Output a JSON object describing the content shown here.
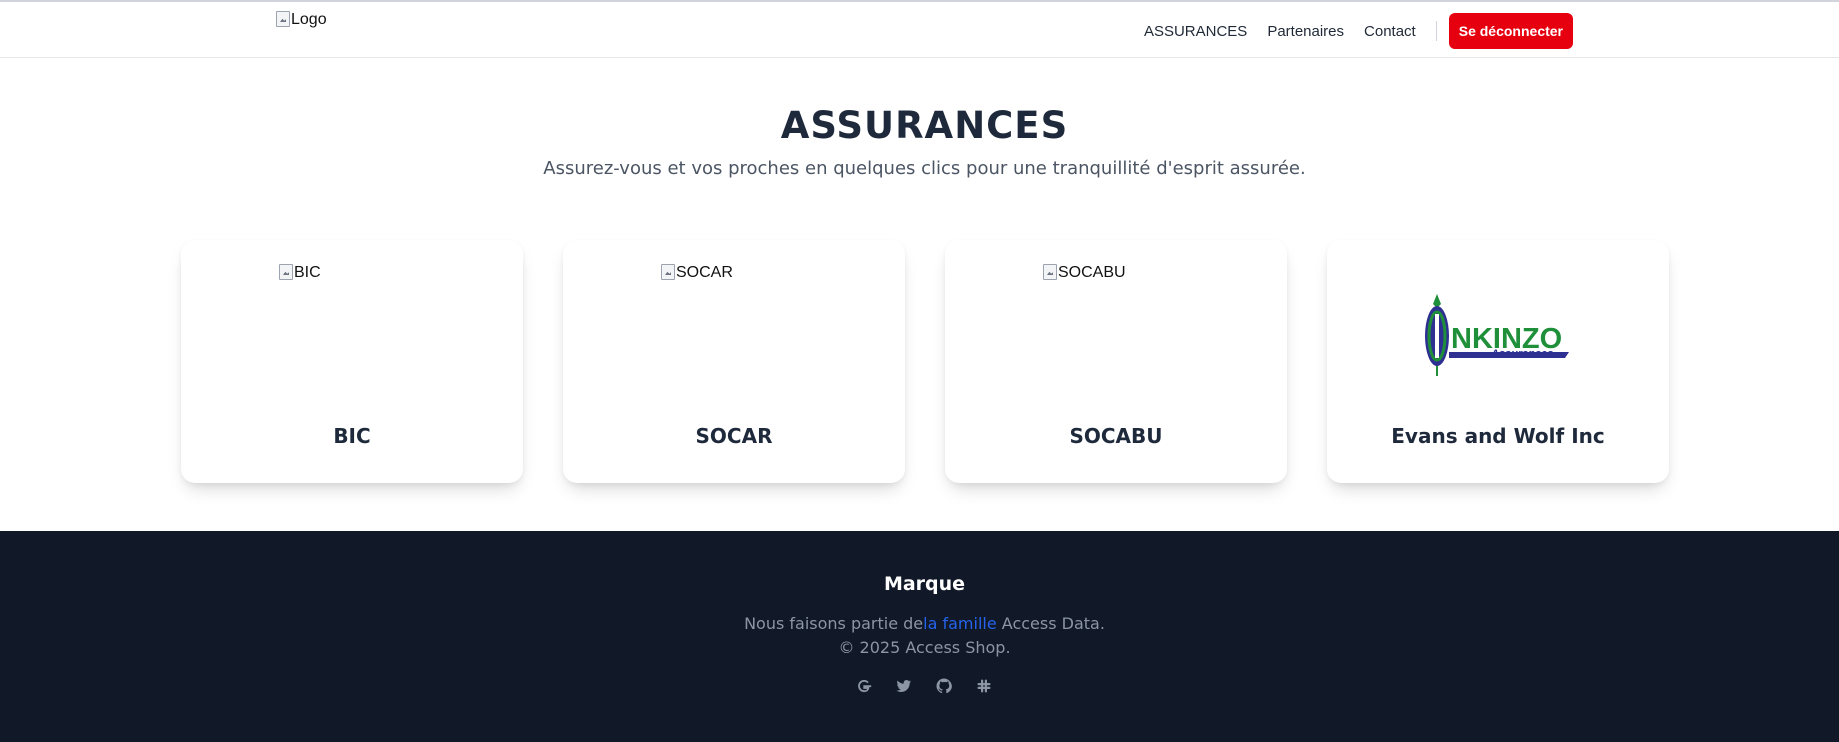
{
  "header": {
    "logo_alt": "Logo",
    "nav": [
      "ASSURANCES",
      "Partenaires",
      "Contact"
    ],
    "logout_label": "Se déconnecter"
  },
  "hero": {
    "title": "ASSURANCES",
    "subtitle": "Assurez-vous et vos proches en quelques clics pour une tranquillité d'esprit assurée."
  },
  "cards": [
    {
      "img_alt": "BIC",
      "name": "BIC"
    },
    {
      "img_alt": "SOCAR",
      "name": "SOCAR"
    },
    {
      "img_alt": "SOCABU",
      "name": "SOCABU"
    },
    {
      "logo_text": "NKINZO",
      "logo_sub": "Assurances",
      "name": "Evans and Wolf Inc"
    }
  ],
  "footer": {
    "brand": "Marque",
    "line1_prefix": "Nous faisons partie de",
    "line1_link": "la famille",
    "line1_suffix": " Access Data.",
    "copyright": "© 2025 Access Shop.",
    "social_icons": [
      "google-icon",
      "twitter-icon",
      "github-icon",
      "slack-icon"
    ]
  },
  "colors": {
    "accent": "#e6000f",
    "footer_bg": "#111827",
    "link": "#2563eb"
  }
}
